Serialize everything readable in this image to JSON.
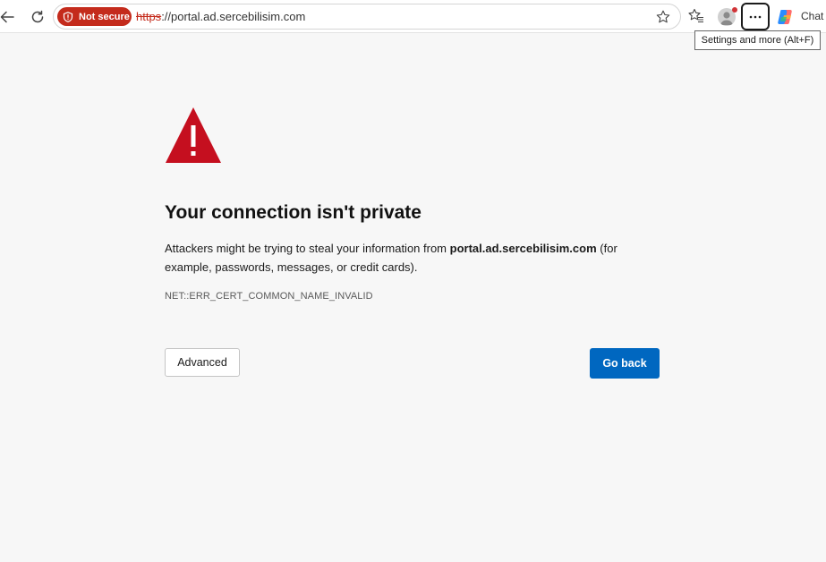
{
  "toolbar": {
    "security_badge": "Not secure",
    "url_scheme": "https",
    "url_rest": "://portal.ad.sercebilisim.com",
    "chat_label": "Chat",
    "tooltip": "Settings and more (Alt+F)"
  },
  "error_page": {
    "title": "Your connection isn't private",
    "description_pre": "Attackers might be trying to steal your information from ",
    "description_domain": "portal.ad.sercebilisim.com",
    "description_post": " (for example, passwords, messages, or credit cards).",
    "error_code": "NET::ERR_CERT_COMMON_NAME_INVALID",
    "advanced_label": "Advanced",
    "go_back_label": "Go back"
  },
  "colors": {
    "warning_red": "#c50f1f",
    "badge_red": "#c42b1c",
    "primary_blue": "#0067c0",
    "page_background": "#f7f7f7"
  }
}
